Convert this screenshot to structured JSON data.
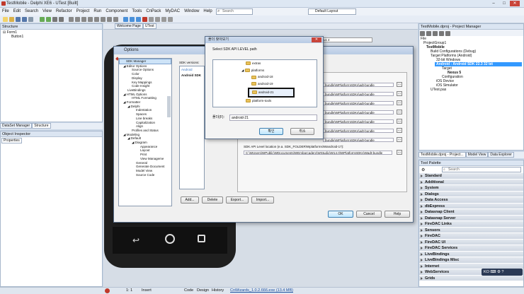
{
  "window": {
    "title": "TestMobile - Delphi XE6 - UTest [Built]",
    "min": "–",
    "max": "□",
    "close": "✕"
  },
  "menu": [
    "File",
    "Edit",
    "Search",
    "View",
    "Refactor",
    "Project",
    "Run",
    "Component",
    "Tools",
    "CnPack",
    "MyDAC",
    "Window",
    "Help"
  ],
  "search": {
    "placeholder": "Search"
  },
  "layout_select": {
    "value": "Default Layout"
  },
  "structure": {
    "title": "Structure",
    "tree": [
      "Form1",
      "Button1"
    ]
  },
  "left_tabs": {
    "tab1": "DataSet Manager",
    "tab2": "Structure"
  },
  "object_inspector": {
    "title": "Object Inspector",
    "tab": "Properties"
  },
  "editor": {
    "tab1": "Welcome Page",
    "tab2": "UTest",
    "device_select": "Nexus 4"
  },
  "options_dialog": {
    "title": "Options",
    "tree": [
      "SDK Manager",
      "Editor Options",
      "Source Options",
      "Color",
      "Display",
      "Key Mappings",
      "Code Insight",
      "LiveBindings",
      "HTML Options",
      "HTML Formatting",
      "Formatter",
      "Delphi",
      "Indentation",
      "Spaces",
      "Line breaks",
      "Capitalization",
      "Align",
      "Profiles and Status",
      "Modeling",
      "Default",
      "Diagram",
      "Appearance",
      "Layout",
      "Print",
      "View Manageme",
      "General",
      "Generate Document",
      "Model View",
      "Source Code"
    ],
    "sdk_versions_label": "SDK versions:",
    "sdk_list": [
      "Android",
      "Android SDK"
    ],
    "path_rows": [
      "bundle\\WPlatformSDKs\\adt-bundle",
      "bundle\\WPlatformSDKs\\adt-bundle",
      "bundle\\WPlatformSDKs\\adt-bundle",
      "bundle\\WPlatformSDKs\\adt-bundle",
      "bundle\\WPlatformSDKs\\adt-bundle",
      "bundle\\WPlatformSDKs\\adt-bundle",
      "bundle\\WPlatformSDKs\\adt-bundle"
    ],
    "api_label": "SDK API Level location (e.a. SDK_FOLDER\\Wplatforms\\Wandroid-17):",
    "api_value": "C:\\WUsers\\WPublic\\WDocuments\\WEmbarcadero\\WStudio\\W14.0\\WPlatformSDKs\\Wadt-bundle",
    "bottom_buttons": [
      "Add...",
      "Delete",
      "Export...",
      "Import..."
    ],
    "ok": "OK",
    "cancel": "Cancel",
    "help": "Help"
  },
  "folder_dialog": {
    "title": "폴더 찾아보기",
    "prompt": "Select SDK API LEVEL path",
    "items": [
      "extras",
      "platforms",
      "android-18",
      "android-19",
      "android-21",
      "platform-tools"
    ],
    "folder_label": "폴더(F):",
    "folder_value": "android-21",
    "ok": "확인",
    "cancel": "취소"
  },
  "project_manager": {
    "title": "TestMobile.dproj - Project Manager",
    "file_label": "File",
    "tree": [
      "ProjectGroup1",
      "TestMobile",
      "Build Configurations (Debug)",
      "Target Platforms (Android)",
      "32-bit Windows",
      "Android - Android SDK 22.3 32 bit",
      "Target",
      "Nexus 5",
      "Configuration",
      "iOS Device",
      "iOS Simulator",
      "UTest.pas"
    ]
  },
  "right_tabs": {
    "tab1": "TestMobile.dproj - Project...",
    "tab2": "Model View",
    "tab3": "Data Explorer"
  },
  "tool_palette": {
    "title": "Tool Palette",
    "search_placeholder": "Search",
    "categories": [
      "Standard",
      "Additional",
      "System",
      "Dialogs",
      "Data Access",
      "dbExpress",
      "Datasnap Client",
      "Datasnap Server",
      "FireDAC Links",
      "Sensors",
      "FireDAC",
      "FireDAC UI",
      "FireDAC Services",
      "LiveBindings",
      "LiveBindings Misc",
      "Internet",
      "WebServices",
      "Grids"
    ]
  },
  "statusbar": {
    "position": "1: 1",
    "mode": "Insert",
    "tabs": [
      "Code",
      "Design",
      "History"
    ],
    "download": "CnWizards_1.0.2.666.exe (13.4 MB)"
  },
  "ime": {
    "label": "KO"
  },
  "colors": {
    "accent": "#3b78c4",
    "selected": "#3399ff",
    "bg": "#c9d6e6"
  }
}
